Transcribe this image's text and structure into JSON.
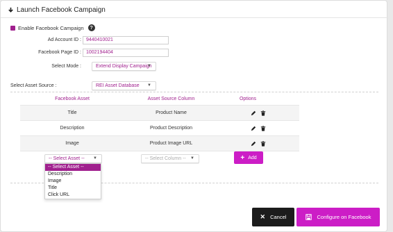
{
  "header": {
    "title": "Launch Facebook Campaign",
    "icon": "download-arrow-icon"
  },
  "enable": {
    "label": "Enable Facebook Campaign",
    "checked": true,
    "help_glyph": "?"
  },
  "form": {
    "ad_account": {
      "label": "Ad Account ID :",
      "value": "9440410021"
    },
    "page_id": {
      "label": "Facebook Page ID :",
      "value": "1002194404"
    },
    "mode": {
      "label": "Select Mode :",
      "value": "Extend Display Campaign"
    },
    "asset_source": {
      "label": "Select Asset Source :",
      "value": "REI Asset Database"
    }
  },
  "table": {
    "headers": [
      "Facebook Asset",
      "Asset Source Column",
      "Options"
    ],
    "rows": [
      {
        "asset": "Title",
        "column": "Product Name"
      },
      {
        "asset": "Description",
        "column": "Product Description"
      },
      {
        "asset": "Image",
        "column": "Product Image URL"
      }
    ]
  },
  "new_row": {
    "asset_select": "-- Select Asset --",
    "column_select": "-- Select Column --",
    "add_label": "Add",
    "add_glyph": "+"
  },
  "dropdown": {
    "options": [
      "-- Select Asset --",
      "Description",
      "Image",
      "Title",
      "Click URL"
    ],
    "selected_index": 0
  },
  "footer": {
    "cancel_label": "Cancel",
    "cancel_glyph": "✕",
    "configure_label": "Configure on Facebook"
  },
  "colors": {
    "accent": "#cc1dc6",
    "accent_text": "#a0208e",
    "dark": "#1c1c1c"
  }
}
